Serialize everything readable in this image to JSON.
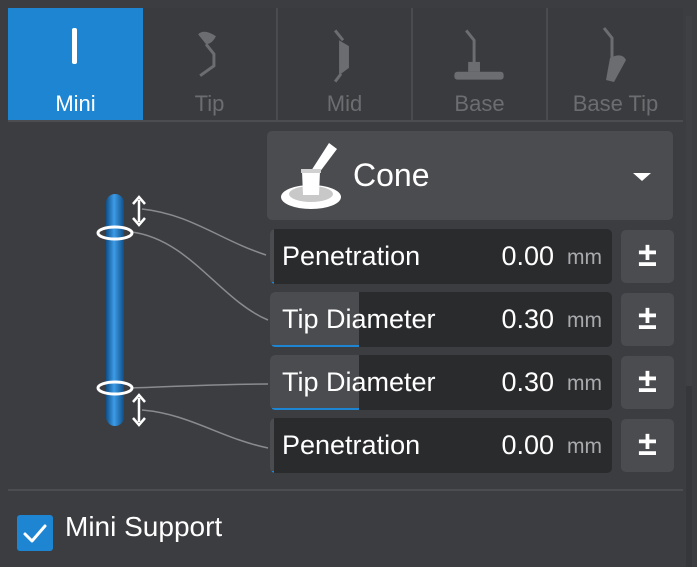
{
  "tabs": [
    {
      "label": "Mini",
      "icon": "mini-support-icon",
      "active": true
    },
    {
      "label": "Tip",
      "icon": "tip-icon",
      "active": false
    },
    {
      "label": "Mid",
      "icon": "mid-icon",
      "active": false
    },
    {
      "label": "Base",
      "icon": "base-icon",
      "active": false
    },
    {
      "label": "Base Tip",
      "icon": "base-tip-icon",
      "active": false
    }
  ],
  "type_select": {
    "label": "Cone",
    "icon": "cone-support-icon"
  },
  "params": [
    {
      "label": "Penetration",
      "value": "0.00",
      "unit": "mm",
      "fill": 0.0
    },
    {
      "label": "Tip Diameter",
      "value": "0.30",
      "unit": "mm",
      "fill": 0.26
    },
    {
      "label": "Tip Diameter",
      "value": "0.30",
      "unit": "mm",
      "fill": 0.26
    },
    {
      "label": "Penetration",
      "value": "0.00",
      "unit": "mm",
      "fill": 0.0
    }
  ],
  "pm_symbol": "±",
  "mini_support": {
    "label": "Mini Support",
    "checked": true
  },
  "colors": {
    "accent": "#1d85d2",
    "panel": "#3c3d40",
    "field": "#2a2b2d",
    "field_fill": "#4b4c50",
    "inactive_text": "#6c6d71"
  }
}
